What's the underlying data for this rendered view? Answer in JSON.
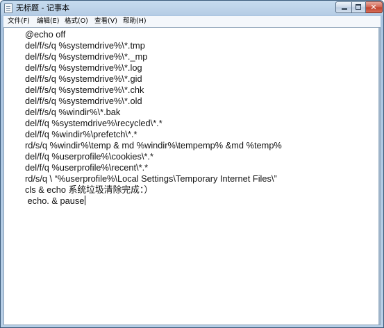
{
  "window": {
    "title": "无标题 - 记事本"
  },
  "controls": {
    "minimize": "minimize",
    "maximize": "maximize",
    "close": "x"
  },
  "menu": [
    {
      "label": "文件(F)"
    },
    {
      "label": "编辑(E)"
    },
    {
      "label": "格式(O)"
    },
    {
      "label": "查看(V)"
    },
    {
      "label": "帮助(H)"
    }
  ],
  "editor": {
    "lines": [
      "@echo off",
      "del/f/s/q %systemdrive%\\*.tmp",
      "del/f/s/q %systemdrive%\\*._mp",
      "del/f/s/q %systemdrive%\\*.log",
      "del/f/s/q %systemdrive%\\*.gid",
      "del/f/s/q %systemdrive%\\*.chk",
      "del/f/s/q %systemdrive%\\*.old",
      "del/f/s/q %windir%\\*.bak",
      "del/f/q %systemdrive%\\recycled\\*.*",
      "del/f/q %windir%\\prefetch\\*.*",
      "rd/s/q %windir%\\temp & md %windir%\\tempemp% &md %temp%",
      "del/f/q %userprofile%\\cookies\\*.*",
      "del/f/q %userprofile%\\recent\\*.*",
      "rd/s/q \\ “%userprofile%\\Local Settings\\Temporary Internet Files\\”",
      "cls & echo 系统垃圾清除完成：）",
      " echo. & pause"
    ]
  }
}
